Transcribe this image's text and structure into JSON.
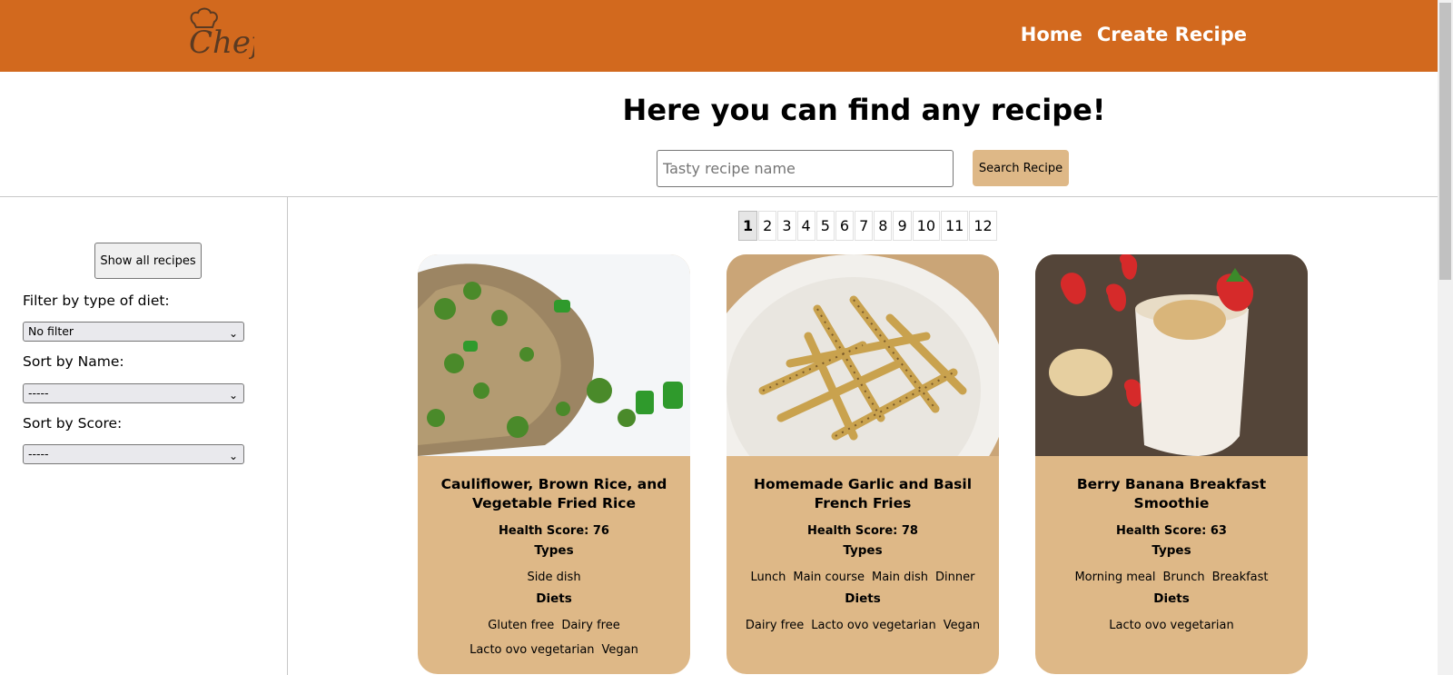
{
  "navbar": {
    "logo_text": "Chef",
    "links": [
      "Home",
      "Create Recipe"
    ]
  },
  "hero": {
    "title": "Here you can find any recipe!",
    "search_placeholder": "Tasty recipe name",
    "search_button": "Search Recipe"
  },
  "sidebar": {
    "show_all": "Show all recipes",
    "diet_label": "Filter by type of diet:",
    "diet_value": "No filter",
    "name_label": "Sort by Name:",
    "name_value": "-----",
    "score_label": "Sort by Score:",
    "score_value": "-----"
  },
  "pagination": [
    "1",
    "2",
    "3",
    "4",
    "5",
    "6",
    "7",
    "8",
    "9",
    "10",
    "11",
    "12"
  ],
  "cards": [
    {
      "title": "Cauliflower, Brown Rice, and Vegetable Fried Rice",
      "score": "Health Score: 76",
      "types_label": "Types",
      "types": [
        "Side dish"
      ],
      "diets_label": "Diets",
      "diets": [
        "Gluten free",
        "Dairy free",
        "Lacto ovo vegetarian",
        "Vegan"
      ]
    },
    {
      "title": "Homemade Garlic and Basil French Fries",
      "score": "Health Score: 78",
      "types_label": "Types",
      "types": [
        "Lunch",
        "Main course",
        "Main dish",
        "Dinner"
      ],
      "diets_label": "Diets",
      "diets": [
        "Dairy free",
        "Lacto ovo vegetarian",
        "Vegan"
      ]
    },
    {
      "title": "Berry Banana Breakfast Smoothie",
      "score": "Health Score: 63",
      "types_label": "Types",
      "types": [
        "Morning meal",
        "Brunch",
        "Breakfast"
      ],
      "diets_label": "Diets",
      "diets": [
        "Lacto ovo vegetarian"
      ]
    }
  ],
  "colors": {
    "navbar": "#d2691e",
    "card": "#deb887",
    "search_button": "#deb887"
  }
}
